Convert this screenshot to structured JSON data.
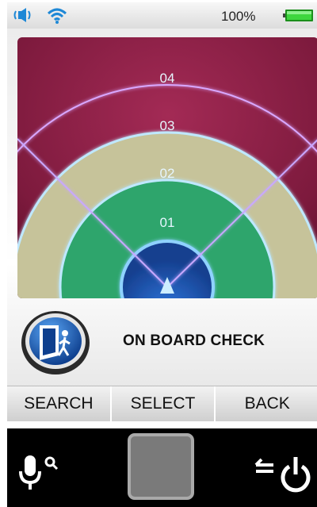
{
  "status_bar": {
    "volume_icon": "speaker-icon",
    "wifi_icon": "wifi-icon",
    "battery_percent": "100%",
    "battery_icon": "battery-full-icon",
    "battery_color": "#22b522"
  },
  "radar": {
    "rings": [
      "04",
      "03",
      "02",
      "01"
    ],
    "center_icon": "up-arrow-icon",
    "colors": {
      "background": "#8e1f45",
      "ring_02": "#c7c49a",
      "ring_01": "#2ea86e",
      "core": "#1a55b5",
      "glow": "#9fd8ff"
    }
  },
  "info": {
    "app_icon": "exit-door-icon",
    "title": "ON BOARD CHECK"
  },
  "softkeys": [
    {
      "label": "SEARCH"
    },
    {
      "label": "SELECT"
    },
    {
      "label": "BACK"
    }
  ],
  "hardware": {
    "left_icon": "microphone-search-icon",
    "center_icon": "home-square-button",
    "right_icon": "back-power-icon"
  }
}
